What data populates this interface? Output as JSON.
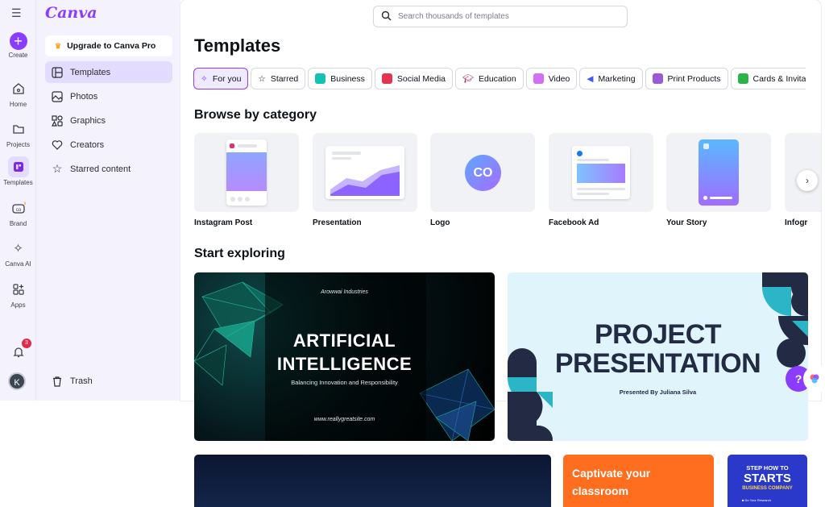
{
  "app": {
    "logo": "Canva"
  },
  "rail": {
    "items": [
      {
        "label": "Create",
        "icon": "plus-icon"
      },
      {
        "label": "Home",
        "icon": "home-icon"
      },
      {
        "label": "Projects",
        "icon": "folder-icon"
      },
      {
        "label": "Templates",
        "icon": "templates-icon"
      },
      {
        "label": "Brand",
        "icon": "brand-icon"
      },
      {
        "label": "Canva AI",
        "icon": "sparkle-icon"
      },
      {
        "label": "Apps",
        "icon": "apps-icon"
      }
    ],
    "notifications_count": "3",
    "avatar_initial": "K"
  },
  "sidebar": {
    "upgrade_label": "Upgrade to Canva Pro",
    "items": [
      {
        "label": "Templates",
        "icon": "templates-icon"
      },
      {
        "label": "Photos",
        "icon": "photo-icon"
      },
      {
        "label": "Graphics",
        "icon": "shapes-icon"
      },
      {
        "label": "Creators",
        "icon": "heart-icon"
      },
      {
        "label": "Starred content",
        "icon": "star-icon"
      }
    ],
    "trash_label": "Trash"
  },
  "search": {
    "placeholder": "Search thousands of templates"
  },
  "main": {
    "title": "Templates",
    "chips": [
      {
        "label": "For you",
        "color": "#8b3dff"
      },
      {
        "label": "Starred",
        "color": "#3d3f4a"
      },
      {
        "label": "Business",
        "color": "#13c2b3"
      },
      {
        "label": "Social Media",
        "color": "#e5344d"
      },
      {
        "label": "Education",
        "color": "#9b1c5a"
      },
      {
        "label": "Video",
        "color": "#d36ff5"
      },
      {
        "label": "Marketing",
        "color": "#3d5afe"
      },
      {
        "label": "Print Products",
        "color": "#9b59d6"
      },
      {
        "label": "Cards & Invita",
        "color": "#2bb34a"
      }
    ],
    "browse_heading": "Browse by category",
    "categories": [
      {
        "label": "Instagram Post"
      },
      {
        "label": "Presentation"
      },
      {
        "label": "Logo",
        "badge": "CO"
      },
      {
        "label": "Facebook Ad"
      },
      {
        "label": "Your Story"
      },
      {
        "label": "Infogr"
      }
    ],
    "explore_heading": "Start exploring",
    "cards": {
      "ai": {
        "brand": "Arowwai Industries",
        "title_line1": "ARTIFICIAL",
        "title_line2": "INTELLIGENCE",
        "subtitle": "Balancing Innovation and Responsibility",
        "url": "www.reallygreatsite.com"
      },
      "project": {
        "title_line1": "PROJECT",
        "title_line2": "PRESENTATION",
        "subtitle": "Presented By Juliana Silva"
      },
      "classroom": {
        "title": "Captivate your classroom"
      },
      "starts": {
        "line1": "STEP HOW TO",
        "line2": "STARTS",
        "line3": "BUSINESS COMPANY",
        "line4": "■ Do Your Research"
      }
    },
    "help_label": "?"
  }
}
